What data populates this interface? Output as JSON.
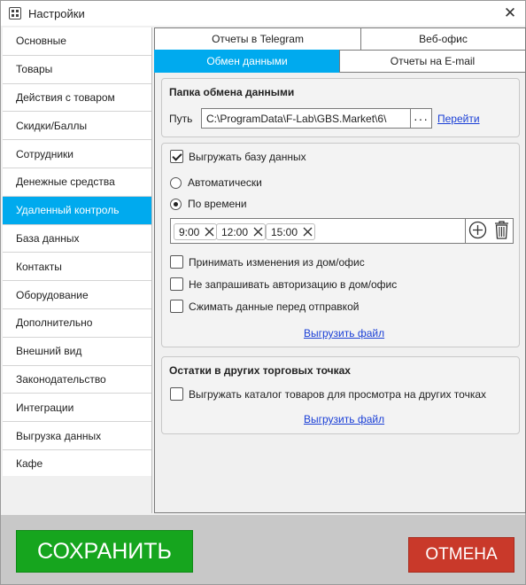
{
  "window": {
    "title": "Настройки"
  },
  "sidebar": {
    "items": [
      {
        "label": "Основные"
      },
      {
        "label": "Товары"
      },
      {
        "label": "Действия с товаром"
      },
      {
        "label": "Скидки/Баллы"
      },
      {
        "label": "Сотрудники"
      },
      {
        "label": "Денежные средства"
      },
      {
        "label": "Удаленный контроль"
      },
      {
        "label": "База данных"
      },
      {
        "label": "Контакты"
      },
      {
        "label": "Оборудование"
      },
      {
        "label": "Дополнительно"
      },
      {
        "label": "Внешний вид"
      },
      {
        "label": "Законодательство"
      },
      {
        "label": "Интеграции"
      },
      {
        "label": "Выгрузка данных"
      },
      {
        "label": "Кафе"
      }
    ],
    "active": "Удаленный контроль"
  },
  "tabs": {
    "row1": [
      {
        "label": "Отчеты в Telegram"
      },
      {
        "label": "Веб-офис"
      }
    ],
    "row2": [
      {
        "label": "Обмен данными"
      },
      {
        "label": "Отчеты на E-mail"
      }
    ],
    "active": "Обмен данными"
  },
  "exchange_folder": {
    "title": "Папка обмена данными",
    "path_label": "Путь",
    "path_value": "C:\\ProgramData\\F-Lab\\GBS.Market\\6\\",
    "browse_label": "···",
    "goto_link": "Перейти"
  },
  "export": {
    "export_db_label": "Выгружать базу данных",
    "export_db_checked": true,
    "mode_auto_label": "Автоматически",
    "mode_time_label": "По времени",
    "selected_mode": "По времени",
    "times": [
      "9:00",
      "12:00",
      "15:00"
    ],
    "accept_changes_label": "Принимать изменения из дом/офис",
    "no_auth_label": "Не запрашивать авторизацию в дом/офис",
    "compress_label": "Сжимать данные перед отправкой",
    "upload_link": "Выгрузить файл"
  },
  "stock": {
    "title": "Остатки в других торговых точках",
    "export_catalog_label": "Выгружать каталог товаров для просмотра на других точках",
    "upload_link": "Выгрузить файл"
  },
  "footer": {
    "save_label": "СОХРАНИТЬ",
    "cancel_label": "ОТМЕНА"
  },
  "colors": {
    "accent": "#00aaee",
    "save": "#16a51e",
    "cancel": "#c9392a",
    "link": "#1a3fd6"
  }
}
